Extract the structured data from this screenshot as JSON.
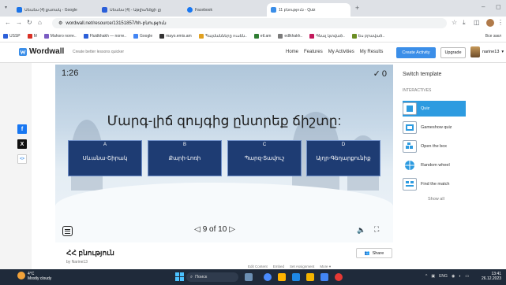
{
  "browser": {
    "tabs": [
      {
        "label": "Սեանս (4) քառակ - Google",
        "color": "#1a73e8"
      },
      {
        "label": "Սեանս (4) - Աթլիս/եծքի լը",
        "color": "#2b5fd9"
      },
      {
        "label": "Facebook",
        "color": "#1877f2"
      },
      {
        "label": "11 բնություն - Quiz",
        "color": "#3b8ee8"
      }
    ],
    "new_tab": "+",
    "minimize": "–",
    "url": "wordwall.net/resource/13151857/hh-բնություն",
    "bookmarks": [
      {
        "label": "USSP",
        "color": "#2b5fd9"
      },
      {
        "label": "M",
        "color": "#d93025"
      },
      {
        "label": "Mahoro norre..",
        "color": "#7a5cc2"
      },
      {
        "label": "Fluidkhakh — norre..",
        "color": "#2b5fd9"
      },
      {
        "label": "Google",
        "color": "#4285f4"
      },
      {
        "label": "mayo.emis.am",
        "color": "#333333"
      },
      {
        "label": "Պայմանները ուսեն..",
        "color": "#e0a020"
      },
      {
        "label": "etl.am",
        "color": "#2f7d32"
      },
      {
        "label": "edlkhakh..",
        "color": "#7a7a7a"
      },
      {
        "label": "Գնալ կտված..",
        "color": "#c2185b"
      },
      {
        "label": "Ես բրաված..",
        "color": "#6b8e23"
      }
    ],
    "all_bookmarks": "Все закл"
  },
  "wordwall": {
    "logo": "Wordwall",
    "tagline": "Create better lessons quicker",
    "nav": [
      "Home",
      "Features",
      "My Activities",
      "My Results"
    ],
    "create": "Create Activity",
    "upgrade": "Upgrade",
    "user": "narine13"
  },
  "social": {
    "facebook": "f",
    "x": "X",
    "embed": "<>"
  },
  "game": {
    "timer": "1:26",
    "score": "0",
    "question": "Մարգ-լիճ զույգից ընտրեք ճիշտը:",
    "answers": [
      {
        "letter": "A",
        "text": "Սևանա-Շիրակ"
      },
      {
        "letter": "B",
        "text": "Քարի-Լոռի"
      },
      {
        "letter": "C",
        "text": "Պարզ-Տավուշ"
      },
      {
        "letter": "D",
        "text": "Այղր-Գեղարքունիք"
      }
    ],
    "page": "9 of 10"
  },
  "activity": {
    "title": "ՀՀ բնություն",
    "author": "by Narine13",
    "share": "Share",
    "links": [
      "Edit Content",
      "Embed",
      "Set Assignment",
      "More ▾"
    ]
  },
  "sidebar": {
    "switch_template": "Switch template",
    "section": "INTERACTIVES",
    "templates": [
      "Quiz",
      "Gameshow quiz",
      "Open the box",
      "Random wheel",
      "Find the match"
    ],
    "show_all": "Show all"
  },
  "taskbar": {
    "temp": "4°C",
    "weather": "Mostly cloudy",
    "search": "Поиск",
    "lang": "ENG",
    "time": "13:41",
    "date": "26.12.2023"
  }
}
